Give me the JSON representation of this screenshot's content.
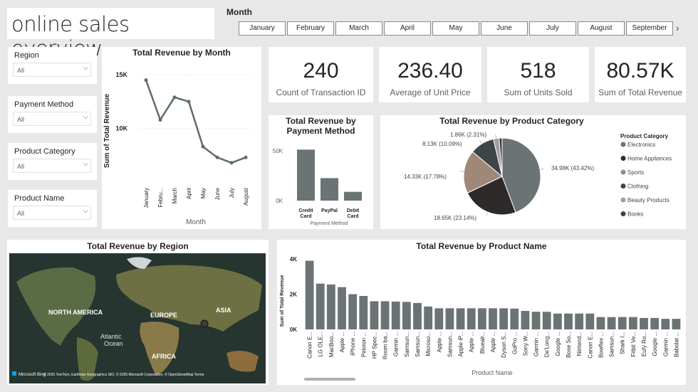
{
  "page_title": "online sales overview",
  "month_slicer": {
    "label": "Month",
    "months": [
      "January",
      "February",
      "March",
      "April",
      "May",
      "June",
      "July",
      "August",
      "September"
    ],
    "next_icon": "chevron-right-icon"
  },
  "slicers": [
    {
      "label": "Region",
      "value": "All"
    },
    {
      "label": "Payment Method",
      "value": "All"
    },
    {
      "label": "Product Category",
      "value": "All"
    },
    {
      "label": "Product Name",
      "value": "All"
    }
  ],
  "kpis": [
    {
      "value": "240",
      "caption": "Count of Transaction ID"
    },
    {
      "value": "236.40",
      "caption": "Average of Unit Price"
    },
    {
      "value": "518",
      "caption": "Sum of Units Sold"
    },
    {
      "value": "80.57K",
      "caption": "Sum of Total Revenue"
    }
  ],
  "chart_data": [
    {
      "id": "month",
      "type": "line",
      "title": "Total Revenue by Month",
      "xlabel": "Month",
      "ylabel": "Sum of Total Revenue",
      "categories": [
        "January",
        "Febru...",
        "March",
        "April",
        "May",
        "June",
        "July",
        "August"
      ],
      "values": [
        14500,
        10800,
        12900,
        12500,
        8300,
        7300,
        6800,
        7300
      ],
      "yticks": [
        "15K",
        "10K"
      ],
      "ylim": [
        5000,
        16000
      ],
      "color": "#5f6b6d"
    },
    {
      "id": "payment",
      "type": "bar",
      "title_line1": "Total Revenue by",
      "title_line2": "Payment Method",
      "xlabel": "Payment Method",
      "categories": [
        "Credit Card",
        "PayPal",
        "Debit Card"
      ],
      "categories_wrapped": [
        [
          "Credit",
          "Card"
        ],
        [
          "PayPal"
        ],
        [
          "Debit",
          "Card"
        ]
      ],
      "values": [
        51200,
        22600,
        8800
      ],
      "yticks": [
        "50K",
        "0K"
      ],
      "ylim": [
        0,
        55000
      ],
      "color": "#6b7375"
    },
    {
      "id": "category",
      "type": "pie",
      "title": "Total Revenue by Product Category",
      "legend_title": "Product Category",
      "legend_position": "right",
      "slices": [
        {
          "name": "Electronics",
          "value": 34980,
          "label": "34.98K (43.42%)",
          "color": "#6b7375"
        },
        {
          "name": "Home Appliances",
          "value": 18650,
          "label": "18.65K (23.14%)",
          "color": "#2e2a2a"
        },
        {
          "name": "Sports",
          "value": 14330,
          "label": "14.33K (17.78%)",
          "color": "#a08878"
        },
        {
          "name": "Clothing",
          "value": 8130,
          "label": "8.13K (10.09%)",
          "color": "#3d4547"
        },
        {
          "name": "Beauty Products",
          "value": 1860,
          "label": "1.86K (2.31%)",
          "color": "#98a2a4"
        },
        {
          "name": "Books",
          "value": 1020,
          "label": "",
          "color": "#5a3a30"
        }
      ]
    },
    {
      "id": "product",
      "type": "bar",
      "title": "Total Revenue by Product Name",
      "xlabel": "Product Name",
      "ylabel": "Sum of Total Revenue",
      "yticks": [
        "4K",
        "2K",
        "0K"
      ],
      "ylim": [
        0,
        4000
      ],
      "color": "#6b7375",
      "categories": [
        "Canon E...",
        "LG OLE...",
        "MacBoo...",
        "Apple ...",
        "iPhone ...",
        "Peloton ...",
        "HP Spec...",
        "Room ba...",
        "Garmin ...",
        "Samsun...",
        "Samsun...",
        "Microso...",
        "Apple ...",
        "Samsun...",
        "Apple iP...",
        "Apple ...",
        "Bluealr...",
        "Apple ...",
        "Dyson S...",
        "GoPro ...",
        "Sony W...",
        "Garmin ...",
        "De'Long...",
        "Google ...",
        "Bose So...",
        "Nintend...",
        "Canon E...",
        "Bowflex ...",
        "Samsun...",
        "Shark I...",
        "Fitbit Ve...",
        "Eufy Ro...",
        "Google ...",
        "Garmin ...",
        "Babolat ..."
      ],
      "values": [
        3900,
        2600,
        2550,
        2400,
        2000,
        1900,
        1600,
        1600,
        1580,
        1560,
        1500,
        1300,
        1200,
        1200,
        1200,
        1200,
        1200,
        1200,
        1200,
        1180,
        1050,
        1000,
        1000,
        900,
        900,
        900,
        900,
        700,
        700,
        700,
        700,
        650,
        650,
        600,
        600
      ]
    }
  ],
  "region_map": {
    "title": "Total Revenue by Region",
    "labels": [
      "NORTH AMERICA",
      "EUROPE",
      "ASIA",
      "AFRICA",
      "Atlantic",
      "Ocean"
    ],
    "attribution": "© 2025 TomTom, Earthstar Geographics SIO, © 2025 Microsoft Corporation, © OpenStreetMap  Terms",
    "logo_text": "Microsoft Bing"
  }
}
